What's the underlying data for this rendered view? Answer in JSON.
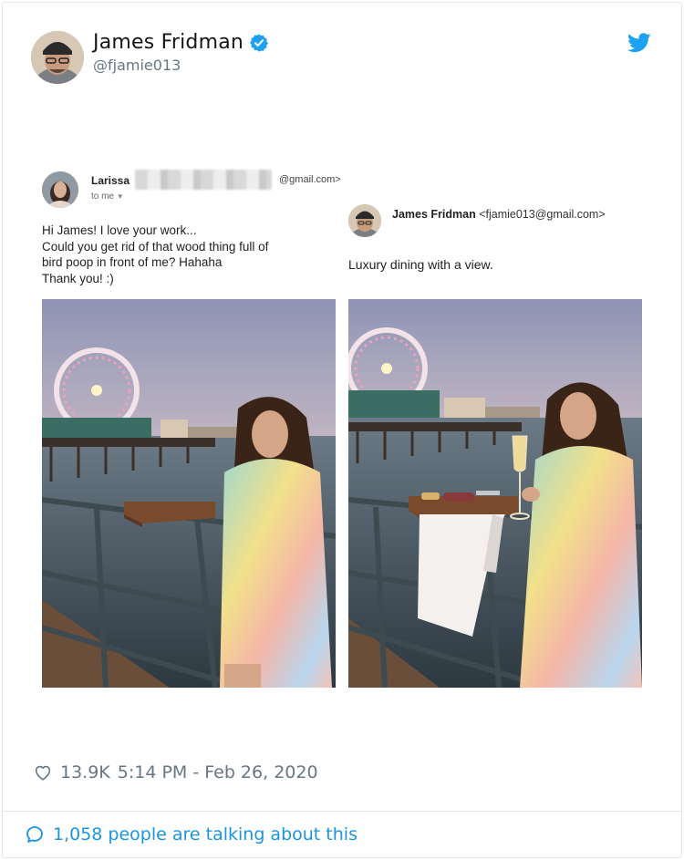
{
  "tweet": {
    "display_name": "James Fridman",
    "handle": "@fjamie013",
    "likes": "13.9K",
    "timestamp": "5:14 PM - Feb 26, 2020",
    "conversation": "1,058 people are talking about this"
  },
  "email_left": {
    "sender_name": "Larissa",
    "sender_email_suffix": "@gmail.com>",
    "to": "to me",
    "body": [
      "Hi James! I love your work...",
      "Could you get rid of that wood thing full of",
      "bird poop in front of me? Hahaha",
      "Thank you! :)"
    ]
  },
  "email_right": {
    "sender_name": "James Fridman",
    "sender_email": "<fjamie013@gmail.com>",
    "body": "Luxury dining with a view."
  },
  "colors": {
    "twitter_blue": "#1da1f2",
    "link_blue": "#1b95e0",
    "muted": "#657786"
  },
  "icons": [
    "verified-badge-icon",
    "twitter-bird-icon",
    "heart-icon",
    "speech-bubble-icon"
  ]
}
